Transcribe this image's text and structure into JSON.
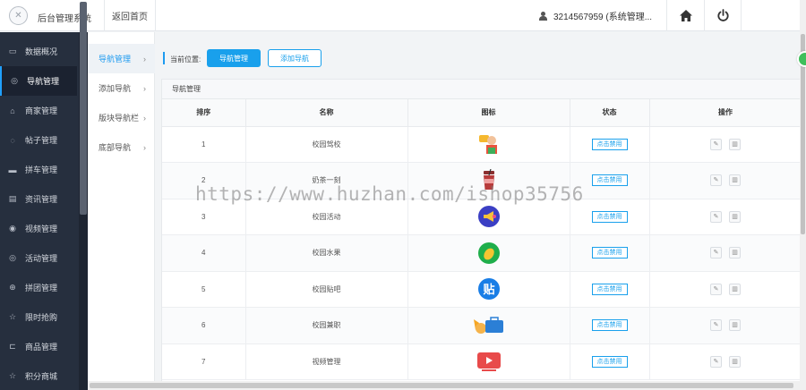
{
  "header": {
    "system_title": "后台管理系统",
    "home_link": "返回首页",
    "user": "3214567959 (系统管理..."
  },
  "sidebar": {
    "items": [
      {
        "label": "数据概况",
        "icon": "monitor-icon"
      },
      {
        "label": "导航管理",
        "icon": "target-icon"
      },
      {
        "label": "商家管理",
        "icon": "bank-icon"
      },
      {
        "label": "帖子管理",
        "icon": "chat-icon"
      },
      {
        "label": "拼车管理",
        "icon": "car-icon"
      },
      {
        "label": "资讯管理",
        "icon": "news-icon"
      },
      {
        "label": "视频管理",
        "icon": "video-icon"
      },
      {
        "label": "活动管理",
        "icon": "activity-icon"
      },
      {
        "label": "拼团管理",
        "icon": "group-icon"
      },
      {
        "label": "限时抢购",
        "icon": "star-icon"
      },
      {
        "label": "商品管理",
        "icon": "cart-icon"
      },
      {
        "label": "积分商城",
        "icon": "points-icon"
      }
    ],
    "active_index": 1
  },
  "subnav": {
    "items": [
      {
        "label": "导航管理"
      },
      {
        "label": "添加导航"
      },
      {
        "label": "版块导航栏"
      },
      {
        "label": "底部导航"
      }
    ]
  },
  "breadcrumb": {
    "label": "当前位置:",
    "current": "导航管理",
    "add": "添加导航"
  },
  "panel": {
    "title": "导航管理",
    "columns": [
      "排序",
      "名称",
      "图标",
      "状态",
      "操作"
    ],
    "rows": [
      {
        "order": "1",
        "name": "校园驾校",
        "icon": "driving-school-icon",
        "status": "点击禁用"
      },
      {
        "order": "2",
        "name": "奶茶一刻",
        "icon": "milk-tea-icon",
        "status": "点击禁用"
      },
      {
        "order": "3",
        "name": "校园活动",
        "icon": "megaphone-icon",
        "status": "点击禁用"
      },
      {
        "order": "4",
        "name": "校园水果",
        "icon": "mango-icon",
        "status": "点击禁用"
      },
      {
        "order": "5",
        "name": "校园贴吧",
        "icon": "tieba-icon",
        "status": "点击禁用",
        "icon_text": "贴"
      },
      {
        "order": "6",
        "name": "校园兼职",
        "icon": "part-time-icon",
        "status": "点击禁用"
      },
      {
        "order": "7",
        "name": "视频管理",
        "icon": "video-play-icon",
        "status": "点击禁用"
      }
    ]
  },
  "watermark": "https://www.huzhan.com/ishop35756",
  "colors": {
    "accent": "#19a0ec",
    "sidebar_bg": "#262f3e",
    "green_badge": "#3fbf5b"
  }
}
